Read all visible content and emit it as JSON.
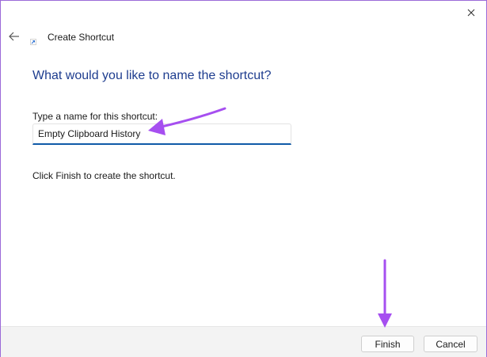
{
  "window": {
    "title": "Create Shortcut"
  },
  "wizard": {
    "heading": "What would you like to name the shortcut?",
    "field_label": "Type a name for this shortcut:",
    "name_value": "Empty Clipboard History",
    "hint": "Click Finish to create the shortcut."
  },
  "footer": {
    "finish_label": "Finish",
    "cancel_label": "Cancel"
  },
  "icons": {
    "close": "close-icon",
    "back": "back-arrow-icon",
    "wizard": "shortcut-icon"
  },
  "colors": {
    "heading": "#1e3d8f",
    "input_underline": "#0f5aa8",
    "annotation_arrow": "#a64ff0",
    "window_border": "#9b6ad8"
  }
}
